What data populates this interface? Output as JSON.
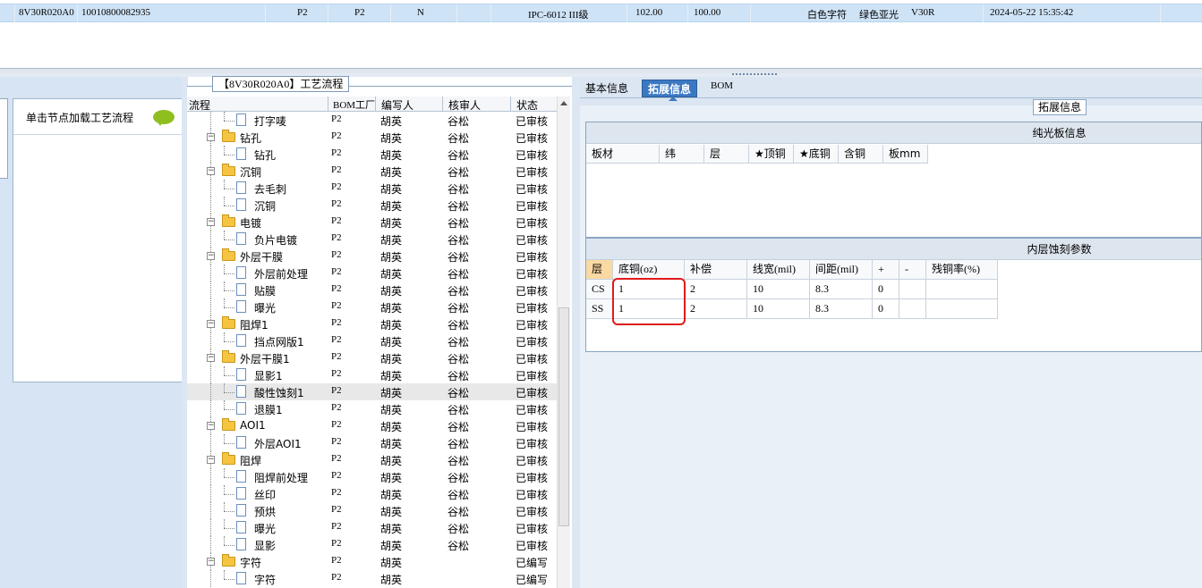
{
  "top_row": {
    "part_no": "8V30R020A0",
    "code": "10010800082935",
    "c1": "P2",
    "c2": "P2",
    "c3": "N",
    "material": "IPC-6012 III级",
    "v1": "102.00",
    "v2": "100.00",
    "char_color": "白色字符",
    "mask_color": "绿色亚光",
    "ver": "V30R",
    "time": "2024-05-22 15:35:42"
  },
  "left_panel": {
    "action_text": "单击节点加载工艺流程"
  },
  "tree": {
    "title": "【8V30R020A0】工艺流程",
    "columns": [
      "流程",
      "BOM工厂",
      "编写人",
      "核审人",
      "状态"
    ],
    "rows": [
      {
        "level": 2,
        "name": "打字唛",
        "factory": "P2",
        "writer": "胡英",
        "reviewer": "谷松",
        "status": "已审核"
      },
      {
        "level": 1,
        "name": "钻孔",
        "factory": "P2",
        "writer": "胡英",
        "reviewer": "谷松",
        "status": "已审核"
      },
      {
        "level": 2,
        "name": "钻孔",
        "factory": "P2",
        "writer": "胡英",
        "reviewer": "谷松",
        "status": "已审核"
      },
      {
        "level": 1,
        "name": "沉铜",
        "factory": "P2",
        "writer": "胡英",
        "reviewer": "谷松",
        "status": "已审核"
      },
      {
        "level": 2,
        "name": "去毛刺",
        "factory": "P2",
        "writer": "胡英",
        "reviewer": "谷松",
        "status": "已审核"
      },
      {
        "level": 2,
        "name": "沉铜",
        "factory": "P2",
        "writer": "胡英",
        "reviewer": "谷松",
        "status": "已审核"
      },
      {
        "level": 1,
        "name": "电镀",
        "factory": "P2",
        "writer": "胡英",
        "reviewer": "谷松",
        "status": "已审核"
      },
      {
        "level": 2,
        "name": "负片电镀",
        "factory": "P2",
        "writer": "胡英",
        "reviewer": "谷松",
        "status": "已审核"
      },
      {
        "level": 1,
        "name": "外层干膜",
        "factory": "P2",
        "writer": "胡英",
        "reviewer": "谷松",
        "status": "已审核"
      },
      {
        "level": 2,
        "name": "外层前处理",
        "factory": "P2",
        "writer": "胡英",
        "reviewer": "谷松",
        "status": "已审核"
      },
      {
        "level": 2,
        "name": "贴膜",
        "factory": "P2",
        "writer": "胡英",
        "reviewer": "谷松",
        "status": "已审核"
      },
      {
        "level": 2,
        "name": "曝光",
        "factory": "P2",
        "writer": "胡英",
        "reviewer": "谷松",
        "status": "已审核"
      },
      {
        "level": 1,
        "name": "阻焊1",
        "factory": "P2",
        "writer": "胡英",
        "reviewer": "谷松",
        "status": "已审核"
      },
      {
        "level": 2,
        "name": "挡点网版1",
        "factory": "P2",
        "writer": "胡英",
        "reviewer": "谷松",
        "status": "已审核"
      },
      {
        "level": 1,
        "name": "外层干膜1",
        "factory": "P2",
        "writer": "胡英",
        "reviewer": "谷松",
        "status": "已审核"
      },
      {
        "level": 2,
        "name": "显影1",
        "factory": "P2",
        "writer": "胡英",
        "reviewer": "谷松",
        "status": "已审核"
      },
      {
        "level": 2,
        "name": "酸性蚀刻1",
        "factory": "P2",
        "writer": "胡英",
        "reviewer": "谷松",
        "status": "已审核",
        "selected": true
      },
      {
        "level": 2,
        "name": "退膜1",
        "factory": "P2",
        "writer": "胡英",
        "reviewer": "谷松",
        "status": "已审核"
      },
      {
        "level": 1,
        "name": "AOI1",
        "factory": "P2",
        "writer": "胡英",
        "reviewer": "谷松",
        "status": "已审核"
      },
      {
        "level": 2,
        "name": "外层AOI1",
        "factory": "P2",
        "writer": "胡英",
        "reviewer": "谷松",
        "status": "已审核"
      },
      {
        "level": 1,
        "name": "阻焊",
        "factory": "P2",
        "writer": "胡英",
        "reviewer": "谷松",
        "status": "已审核"
      },
      {
        "level": 2,
        "name": "阻焊前处理",
        "factory": "P2",
        "writer": "胡英",
        "reviewer": "谷松",
        "status": "已审核"
      },
      {
        "level": 2,
        "name": "丝印",
        "factory": "P2",
        "writer": "胡英",
        "reviewer": "谷松",
        "status": "已审核"
      },
      {
        "level": 2,
        "name": "预烘",
        "factory": "P2",
        "writer": "胡英",
        "reviewer": "谷松",
        "status": "已审核"
      },
      {
        "level": 2,
        "name": "曝光",
        "factory": "P2",
        "writer": "胡英",
        "reviewer": "谷松",
        "status": "已审核"
      },
      {
        "level": 2,
        "name": "显影",
        "factory": "P2",
        "writer": "胡英",
        "reviewer": "谷松",
        "status": "已审核"
      },
      {
        "level": 1,
        "name": "字符",
        "factory": "P2",
        "writer": "胡英",
        "reviewer": "",
        "status": "已编写"
      },
      {
        "level": 2,
        "name": "字符",
        "factory": "P2",
        "writer": "胡英",
        "reviewer": "",
        "status": "已编写"
      }
    ]
  },
  "right_tabs": [
    "基本信息",
    "拓展信息",
    "BOM"
  ],
  "active_tab": "拓展信息",
  "ext_legend": "拓展信息",
  "bare_board": {
    "title": "纯光板信息",
    "columns": [
      "板材",
      "纬",
      "层",
      "★顶铜",
      "★底铜",
      "含铜",
      "板mm"
    ]
  },
  "inner_etch": {
    "title": "内层蚀刻参数",
    "columns": [
      "层",
      "底铜(oz)",
      "补偿",
      "线宽(mil)",
      "间距(mil)",
      "+",
      "-",
      "残铜率(%)"
    ],
    "rows": [
      [
        "CS",
        "1",
        "2",
        "10",
        "8.3",
        "0",
        "",
        ""
      ],
      [
        "SS",
        "1",
        "2",
        "10",
        "8.3",
        "0",
        "",
        ""
      ]
    ]
  },
  "colors": {
    "accent": "#3b78c2",
    "highlight_box": "#e01b1b",
    "selected_row": "#cfe3f7"
  }
}
